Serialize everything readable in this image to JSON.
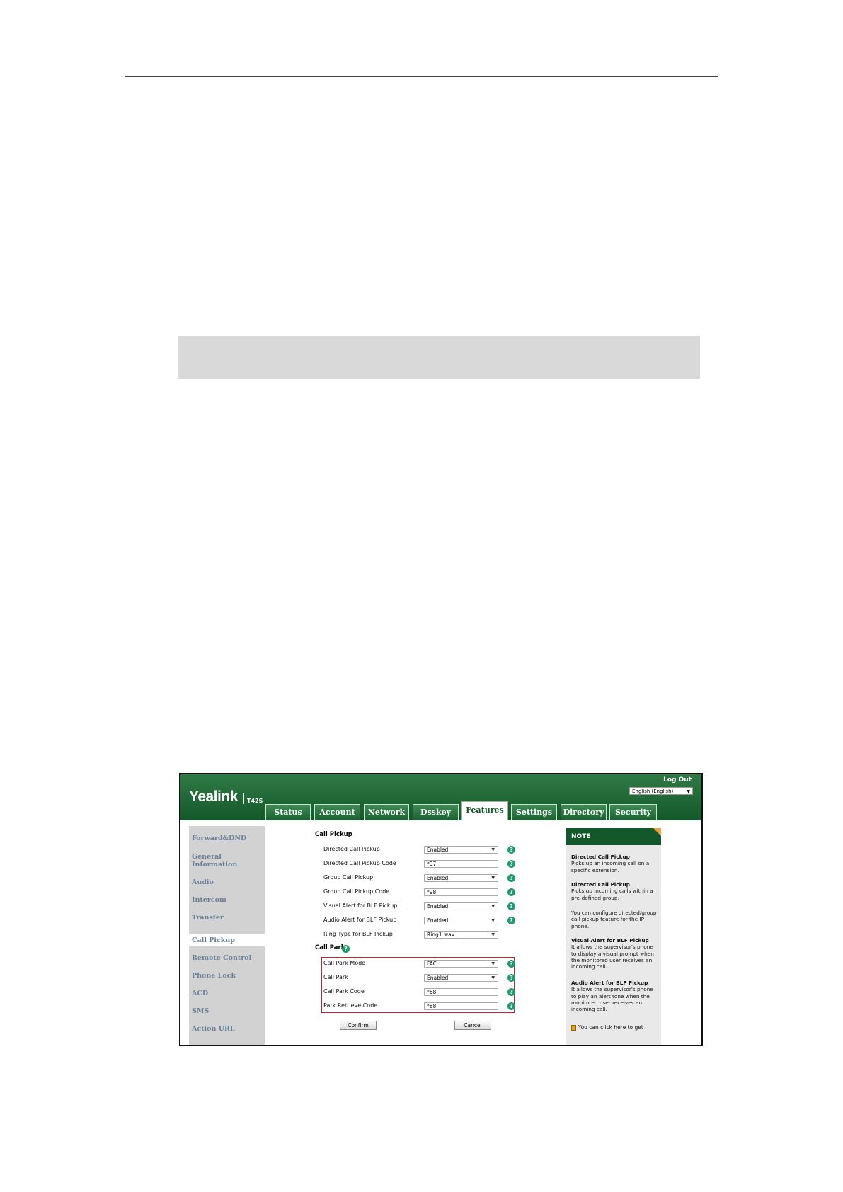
{
  "app": {
    "logo": "Yealink",
    "model": "T42S",
    "logout": "Log Out",
    "language": "English (English)"
  },
  "tabs": [
    "Status",
    "Account",
    "Network",
    "Dsskey",
    "Features",
    "Settings",
    "Directory",
    "Security"
  ],
  "active_tab": "Features",
  "sidebar": [
    "Forward&DND",
    "General Information",
    "Audio",
    "Intercom",
    "Transfer",
    "Call Pickup",
    "Remote Control",
    "Phone Lock",
    "ACD",
    "SMS",
    "Action URL"
  ],
  "active_sidebar": "Call Pickup",
  "call_pickup": {
    "title": "Call Pickup",
    "rows": [
      {
        "label": "Directed Call Pickup",
        "value": "Enabled",
        "type": "select"
      },
      {
        "label": "Directed Call Pickup Code",
        "value": "*97",
        "type": "text"
      },
      {
        "label": "Group Call Pickup",
        "value": "Enabled",
        "type": "select"
      },
      {
        "label": "Group Call Pickup Code",
        "value": "*98",
        "type": "text"
      },
      {
        "label": "Visual Alert for BLF Pickup",
        "value": "Enabled",
        "type": "select"
      },
      {
        "label": "Audio Alert for BLF Pickup",
        "value": "Enabled",
        "type": "select"
      },
      {
        "label": "Ring Type for BLF Pickup",
        "value": "Ring1.wav",
        "type": "select"
      }
    ]
  },
  "call_park": {
    "title": "Call Park",
    "rows": [
      {
        "label": "Call Park Mode",
        "value": "FAC",
        "type": "select"
      },
      {
        "label": "Call Park",
        "value": "Enabled",
        "type": "select"
      },
      {
        "label": "Call Park Code",
        "value": "*68",
        "type": "text"
      },
      {
        "label": "Park Retrieve Code",
        "value": "*88",
        "type": "text"
      }
    ]
  },
  "buttons": {
    "confirm": "Confirm",
    "cancel": "Cancel"
  },
  "note": {
    "title": "NOTE",
    "items": [
      {
        "heading": "Directed Call Pickup",
        "text": "Picks up an incoming call on a specific extension."
      },
      {
        "heading": "Directed Call Pickup",
        "text": "Picks up incoming calls within a pre-defined group."
      },
      {
        "heading": "",
        "text": "You can configure directed/group call pickup feature for the IP phone."
      },
      {
        "heading": "Visual Alert for BLF Pickup",
        "text": "It allows the supervisor's phone to display a visual prompt when the monitored user receives an incoming call."
      },
      {
        "heading": "Audio Alert for BLF Pickup",
        "text": "It allows the supervisor's phone to play an alert tone when the monitored user receives an incoming call."
      }
    ],
    "footer": "You can click here to get"
  },
  "colors": {
    "brand_green": "#13582a",
    "highlight_red": "#d0212a",
    "help_icon": "#1f9a6c"
  }
}
